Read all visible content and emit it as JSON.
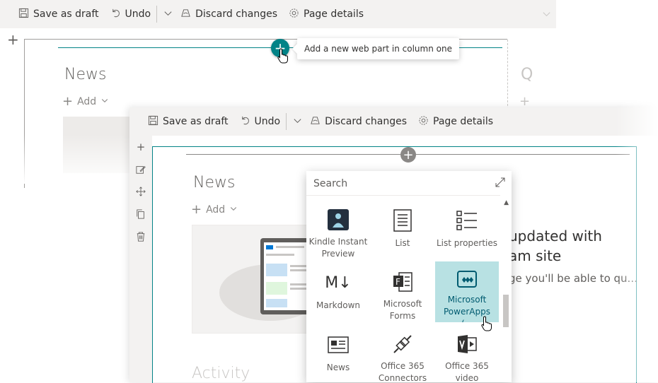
{
  "toolbar": {
    "save_label": "Save as draft",
    "undo_label": "Undo",
    "discard_label": "Discard changes",
    "details_label": "Page details"
  },
  "background": {
    "news_title": "News",
    "add_label": "Add",
    "right_column_partial": "Q",
    "tooltip": "Add a new web part in column one"
  },
  "foreground": {
    "news_title": "News",
    "add_label": "Add",
    "activity_title": "Activity",
    "right_title_line1": "updated with",
    "right_title_line2": "am site",
    "right_body": "ge you'll be able to qu..."
  },
  "picker": {
    "search_placeholder": "Search",
    "tiles": [
      {
        "label": "Kindle Instant Preview",
        "icon": "kindle-icon"
      },
      {
        "label": "List",
        "icon": "list-icon"
      },
      {
        "label": "List properties",
        "icon": "list-properties-icon"
      },
      {
        "label": "Markdown",
        "icon": "markdown-icon"
      },
      {
        "label": "Microsoft Forms",
        "icon": "forms-icon"
      },
      {
        "label": "Microsoft PowerApps (...",
        "icon": "powerapps-icon",
        "selected": true
      },
      {
        "label": "News",
        "icon": "news-icon"
      },
      {
        "label": "Office 365 Connectors",
        "icon": "connectors-icon"
      },
      {
        "label": "Office 365 video",
        "icon": "video-icon"
      }
    ]
  },
  "colors": {
    "accent": "#038387",
    "selected_tile": "#b8e1e3",
    "toolbar_bg": "#f3f2f1"
  }
}
